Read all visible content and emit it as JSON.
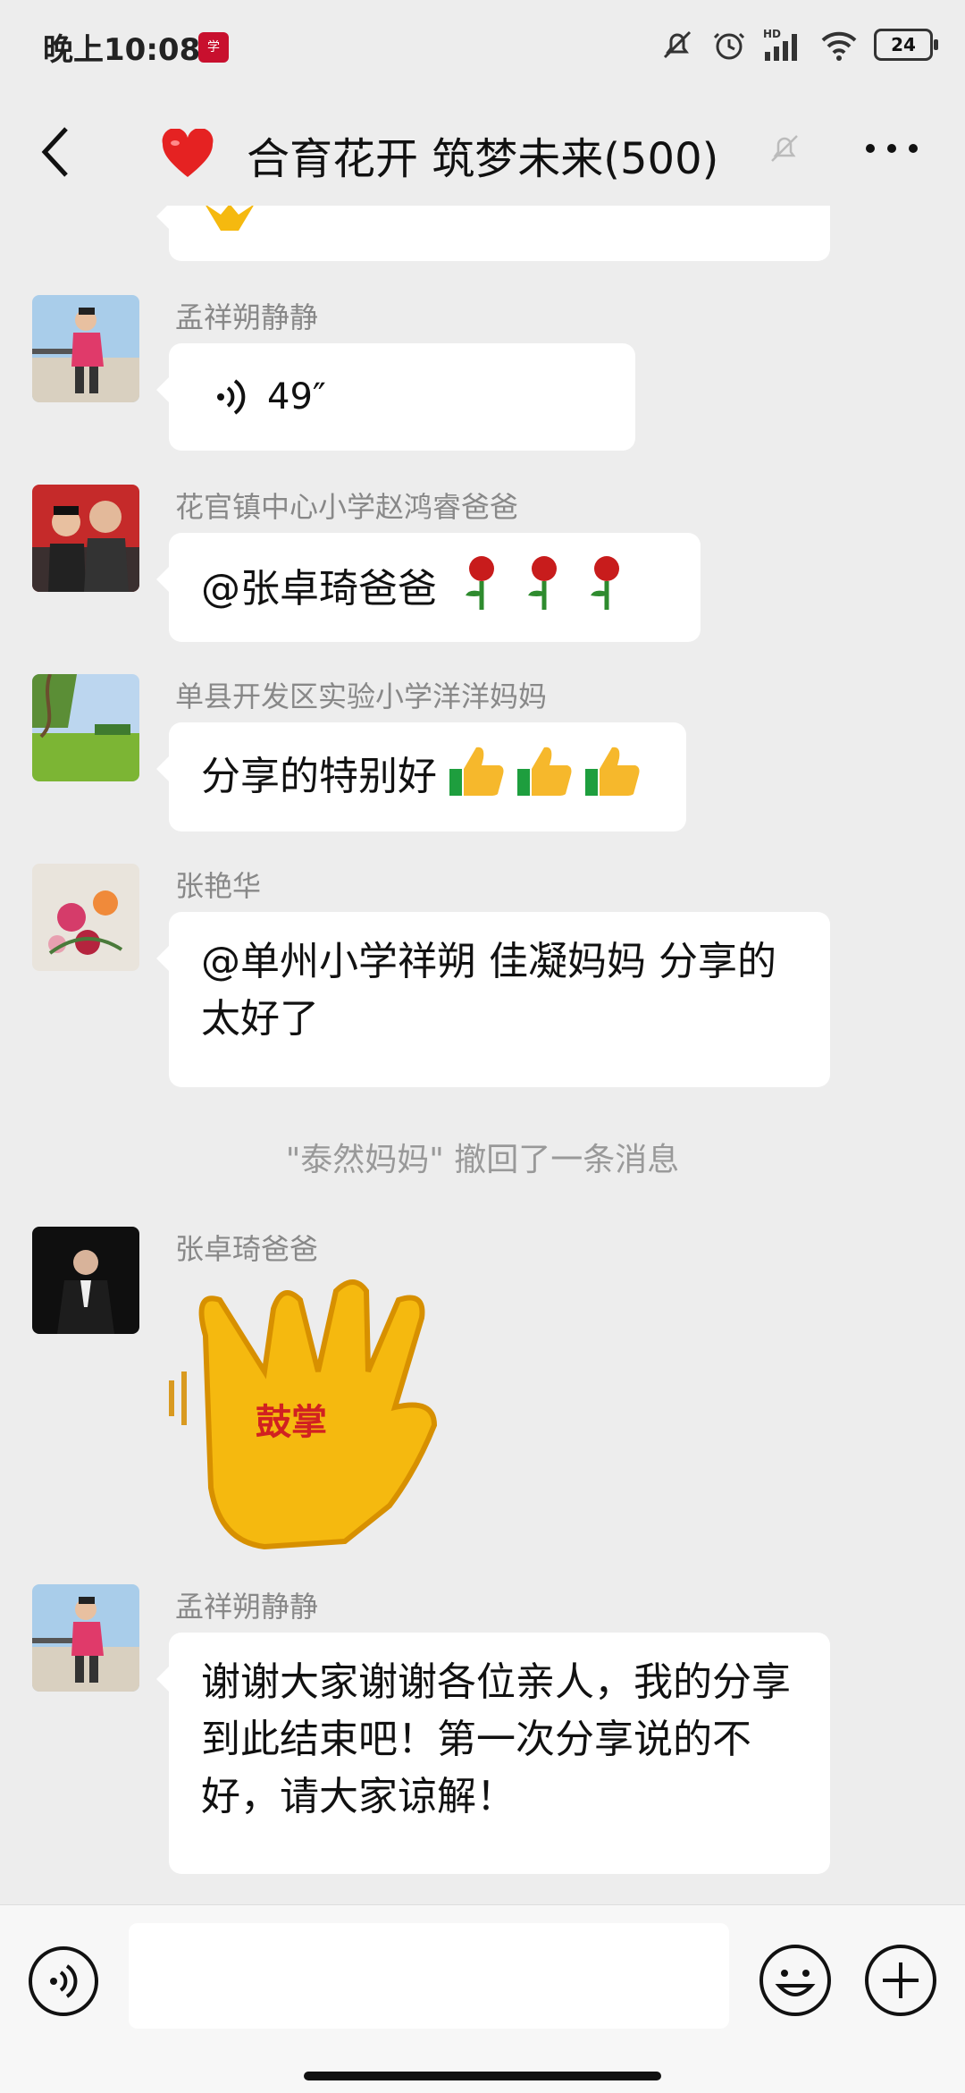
{
  "status_bar": {
    "time": "晚上10:08",
    "battery": "24",
    "network_label": "HD"
  },
  "nav": {
    "title": "合育花开 筑梦未来(500)"
  },
  "messages": [
    {
      "sender": "孟祥朔静静",
      "voice_duration": "49″"
    },
    {
      "sender": "花官镇中心小学赵鸿睿爸爸",
      "text": "@张卓琦爸爸 "
    },
    {
      "sender": "单县开发区实验小学洋洋妈妈",
      "text": "分享的特别好"
    },
    {
      "sender": "张艳华",
      "text": "@单州小学祥朔 佳凝妈妈  分享的太好了"
    },
    {
      "sender": "张卓琦爸爸",
      "sticker_text": "鼓掌"
    },
    {
      "sender": "孟祥朔静静",
      "text": "谢谢大家谢谢各位亲人，我的分享到此结束吧！第一次分享说的不好，请大家谅解！"
    }
  ],
  "system": {
    "recall": "\"泰然妈妈\" 撤回了一条消息"
  },
  "input": {
    "placeholder": ""
  },
  "colors": {
    "background": "#ededed",
    "bubble": "#ffffff",
    "sticker": "#f5b90f"
  }
}
